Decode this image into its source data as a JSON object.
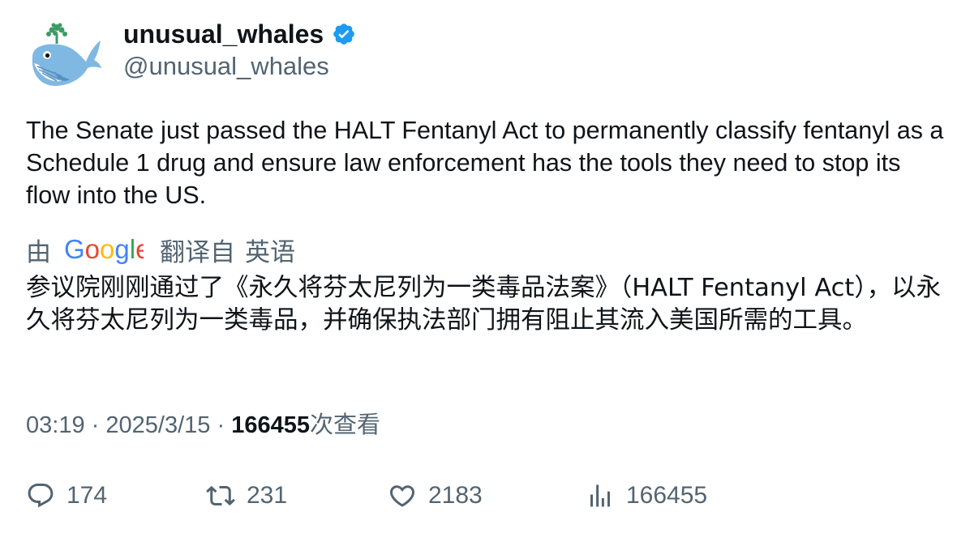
{
  "author": {
    "display_name": "unusual_whales",
    "handle": "@unusual_whales",
    "verified": true
  },
  "tweet": {
    "text": "The Senate just passed the HALT Fentanyl Act to permanently classify fentanyl as a Schedule 1 drug and ensure law enforcement has the tools they need to stop its flow into the US."
  },
  "translation": {
    "by_label": "由",
    "provider": "Google",
    "from_label": "翻译自",
    "language": "英语",
    "text": "参议院刚刚通过了《永久将芬太尼列为一类毒品法案》（HALT Fentanyl Act），以永久将芬太尼列为一类毒品，并确保执法部门拥有阻止其流入美国所需的工具。"
  },
  "meta": {
    "time": "03:19",
    "separator": "·",
    "date": "2025/3/15",
    "views_count": "166455",
    "views_label": "次查看"
  },
  "actions": {
    "replies": "174",
    "retweets": "231",
    "likes": "2183",
    "views": "166455"
  },
  "colors": {
    "text_primary": "#0f1419",
    "text_secondary": "#536471",
    "verified": "#1d9bf0",
    "whale_body": "#7fb8e3",
    "google_blue": "#4285f4",
    "google_red": "#ea4335",
    "google_yellow": "#fbbc05",
    "google_green": "#34a853"
  },
  "icons": {
    "avatar": "whale-logo",
    "verified": "verified-badge-icon",
    "reply": "reply-icon",
    "retweet": "retweet-icon",
    "like": "heart-icon",
    "views": "bar-chart-icon"
  }
}
